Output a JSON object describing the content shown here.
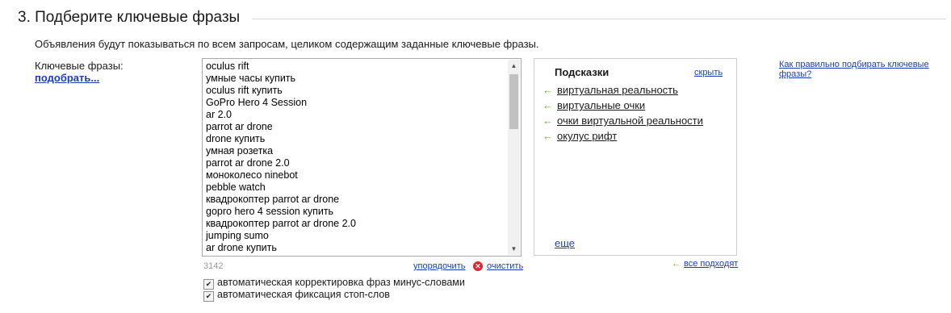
{
  "section": {
    "title": "3. Подберите ключевые фразы",
    "description": "Объявления будут показываться по всем запросам, целиком содержащим заданные ключевые фразы."
  },
  "keywords": {
    "label": "Ключевые фразы:",
    "pick_link": "подобрать...",
    "lines": [
      "oculus rift",
      "умные часы купить",
      "oculus rift купить",
      "GoPro Hero 4 Session",
      "ar 2.0",
      "parrot ar drone",
      "drone купить",
      "умная розетка",
      "parrot ar drone 2.0",
      "моноколесо ninebot",
      "pebble watch",
      "квадрокоптер parrot ar drone",
      "gopro hero 4 session купить",
      "квадрокоптер parrot ar drone 2.0",
      "jumping sumo",
      "ar drone купить"
    ],
    "count": "3142",
    "order_link": "упорядочить",
    "clear_link": "очистить"
  },
  "options": {
    "autocorrect_label": "автоматическая корректировка фраз минус-словами",
    "autocorrect_checked": true,
    "stopwords_label": "автоматическая фиксация стоп-слов",
    "stopwords_checked": true
  },
  "hints": {
    "title": "Подсказки",
    "hide_link": "скрыть",
    "items": [
      "виртуальная реальность",
      "виртуальные очки",
      "очки виртуальной реальности",
      "окулус рифт"
    ],
    "more_link": "еще",
    "all_fit_link": "все подходят"
  },
  "help_link": "Как правильно подбирать ключевые фразы?",
  "colors": {
    "link": "#1a3dc1",
    "hint_arrow": "#6ab520",
    "clear_icon": "#e0262b"
  }
}
